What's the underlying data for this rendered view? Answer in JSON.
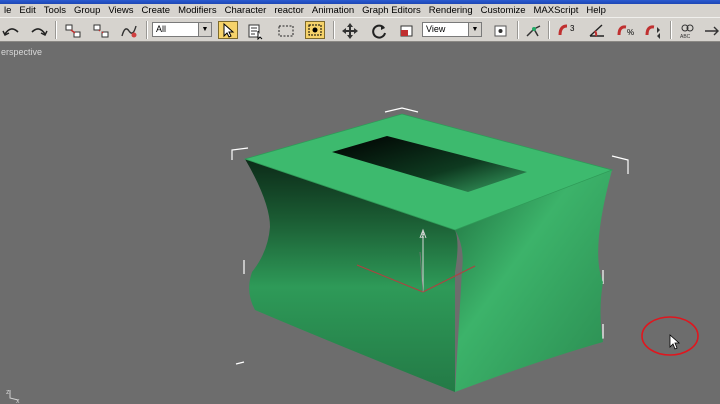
{
  "menu": [
    "le",
    "Edit",
    "Tools",
    "Group",
    "Views",
    "Create",
    "Modifiers",
    "Character",
    "reactor",
    "Animation",
    "Graph Editors",
    "Rendering",
    "Customize",
    "MAXScript",
    "Help"
  ],
  "toolbar": {
    "selection_filter": "All",
    "reference_coord": "View"
  },
  "viewport": {
    "label": "erspective",
    "axis_labels": {
      "z": "z",
      "x": "x"
    }
  },
  "colors": {
    "object_green": "#3dba6e",
    "highlight_circle": "#e0161e",
    "active_button": "#f6d36a"
  }
}
